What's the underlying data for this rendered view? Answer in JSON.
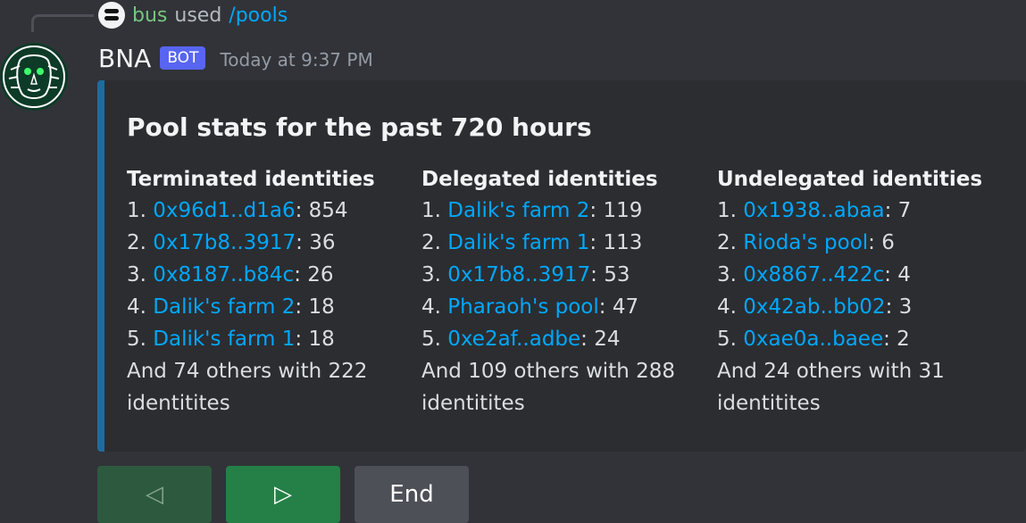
{
  "reply": {
    "username": "bus",
    "used": "used",
    "command": "/pools"
  },
  "message": {
    "author": "BNA",
    "bot_tag": "BOT",
    "timestamp": "Today at 9:37 PM"
  },
  "embed": {
    "title": "Pool stats for the past 720 hours",
    "accent_color": "#1f6ba0",
    "columns": [
      {
        "name": "Terminated identities",
        "entries": [
          {
            "num": "1.",
            "link": "0x96d1..d1a6",
            "value": ": 854"
          },
          {
            "num": "2.",
            "link": "0x17b8..3917",
            "value": ": 36"
          },
          {
            "num": "3.",
            "link": "0x8187..b84c",
            "value": ": 26"
          },
          {
            "num": "4.",
            "link": "Dalik's farm 2",
            "value": ": 18"
          },
          {
            "num": "5.",
            "link": "Dalik's farm 1",
            "value": ": 18"
          }
        ],
        "others": "And 74 others with 222 identitites"
      },
      {
        "name": "Delegated identities",
        "entries": [
          {
            "num": "1.",
            "link": "Dalik's farm 2",
            "value": ": 119"
          },
          {
            "num": "2.",
            "link": "Dalik's farm 1",
            "value": ": 113"
          },
          {
            "num": "3.",
            "link": "0x17b8..3917",
            "value": ": 53"
          },
          {
            "num": "4.",
            "link": "Pharaoh's pool",
            "value": ": 47"
          },
          {
            "num": "5.",
            "link": "0xe2af..adbe",
            "value": ": 24"
          }
        ],
        "others": "And 109 others with 288 identitites"
      },
      {
        "name": "Undelegated identities",
        "entries": [
          {
            "num": "1.",
            "link": "0x1938..abaa",
            "value": ": 7"
          },
          {
            "num": "2.",
            "link": "Rioda's pool",
            "value": ": 6"
          },
          {
            "num": "3.",
            "link": "0x8867..422c",
            "value": ": 4"
          },
          {
            "num": "4.",
            "link": "0x42ab..bb02",
            "value": ": 3"
          },
          {
            "num": "5.",
            "link": "0xae0a..baee",
            "value": ": 2"
          }
        ],
        "others": "And 24 others with 31 identitites"
      }
    ]
  },
  "buttons": {
    "prev_label": "◁",
    "next_label": "▷",
    "end_label": "End"
  }
}
